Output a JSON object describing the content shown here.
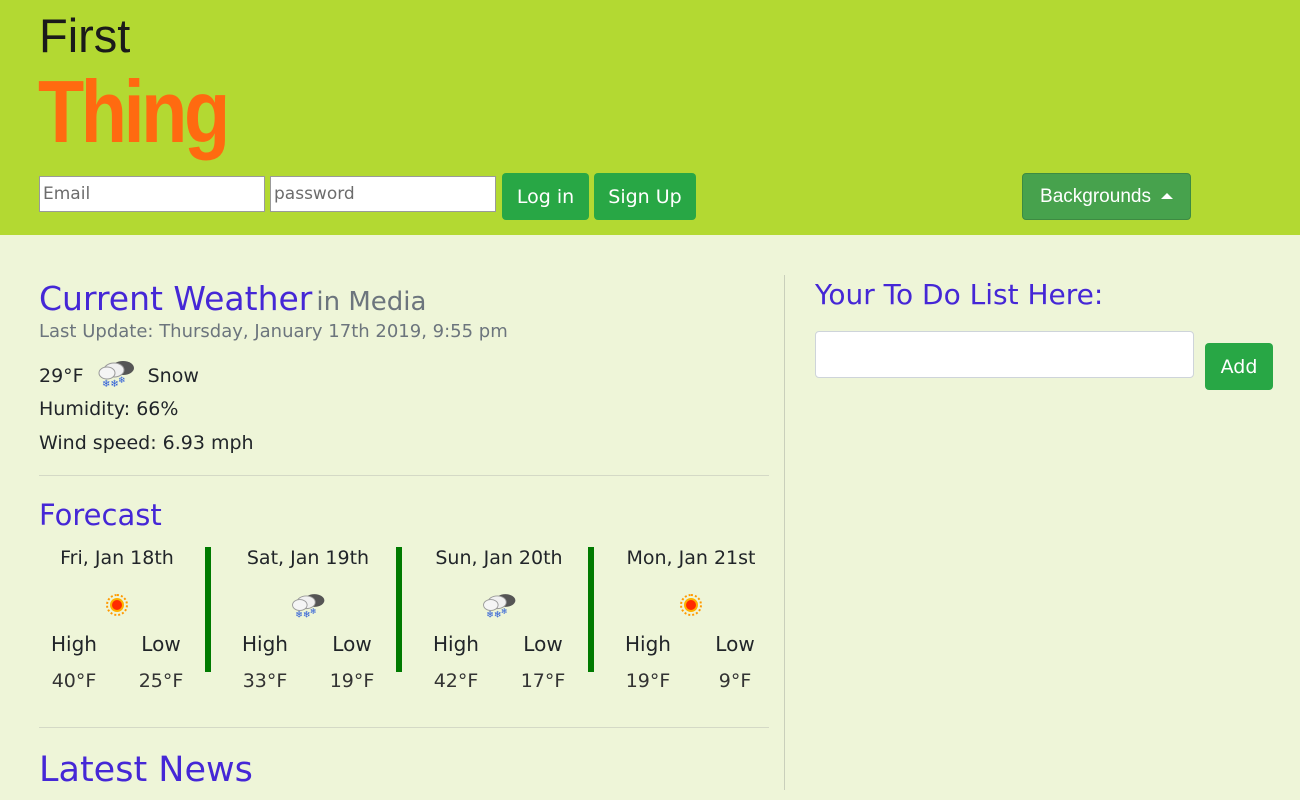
{
  "header": {
    "brand_first": "First",
    "brand_thing": "Thing",
    "email_placeholder": "Email",
    "password_placeholder": "password",
    "login_label": "Log in",
    "signup_label": "Sign Up",
    "backgrounds_label": "Backgrounds",
    "backgrounds_icon": "caret-up-icon"
  },
  "weather": {
    "title": "Current Weather",
    "city": "in Media",
    "last_update": "Last Update: Thursday, January 17th 2019, 9:55 pm",
    "temperature": "29°F",
    "condition_icon": "snow-icon",
    "condition": "Snow",
    "humidity": "Humidity: 66%",
    "wind": "Wind speed: 6.93 mph"
  },
  "forecast": {
    "title": "Forecast",
    "high_label": "High",
    "low_label": "Low",
    "days": [
      {
        "date": "Fri, Jan 18th",
        "icon": "sun-icon",
        "high": "40°F",
        "low": "25°F"
      },
      {
        "date": "Sat, Jan 19th",
        "icon": "snow-icon",
        "high": "33°F",
        "low": "19°F"
      },
      {
        "date": "Sun, Jan 20th",
        "icon": "snow-icon",
        "high": "42°F",
        "low": "17°F"
      },
      {
        "date": "Mon, Jan 21st",
        "icon": "sun-icon",
        "high": "19°F",
        "low": "9°F"
      }
    ]
  },
  "news": {
    "title": "Latest News"
  },
  "todo": {
    "title": "Your To Do List Here:",
    "input_value": "",
    "add_label": "Add"
  },
  "colors": {
    "header_bg": "#b3d932",
    "body_bg": "#eef5d8",
    "brand_orange": "#ff6a10",
    "heading_purple": "#4527d6",
    "button_green": "#28a745",
    "separator_green": "#007a00"
  }
}
